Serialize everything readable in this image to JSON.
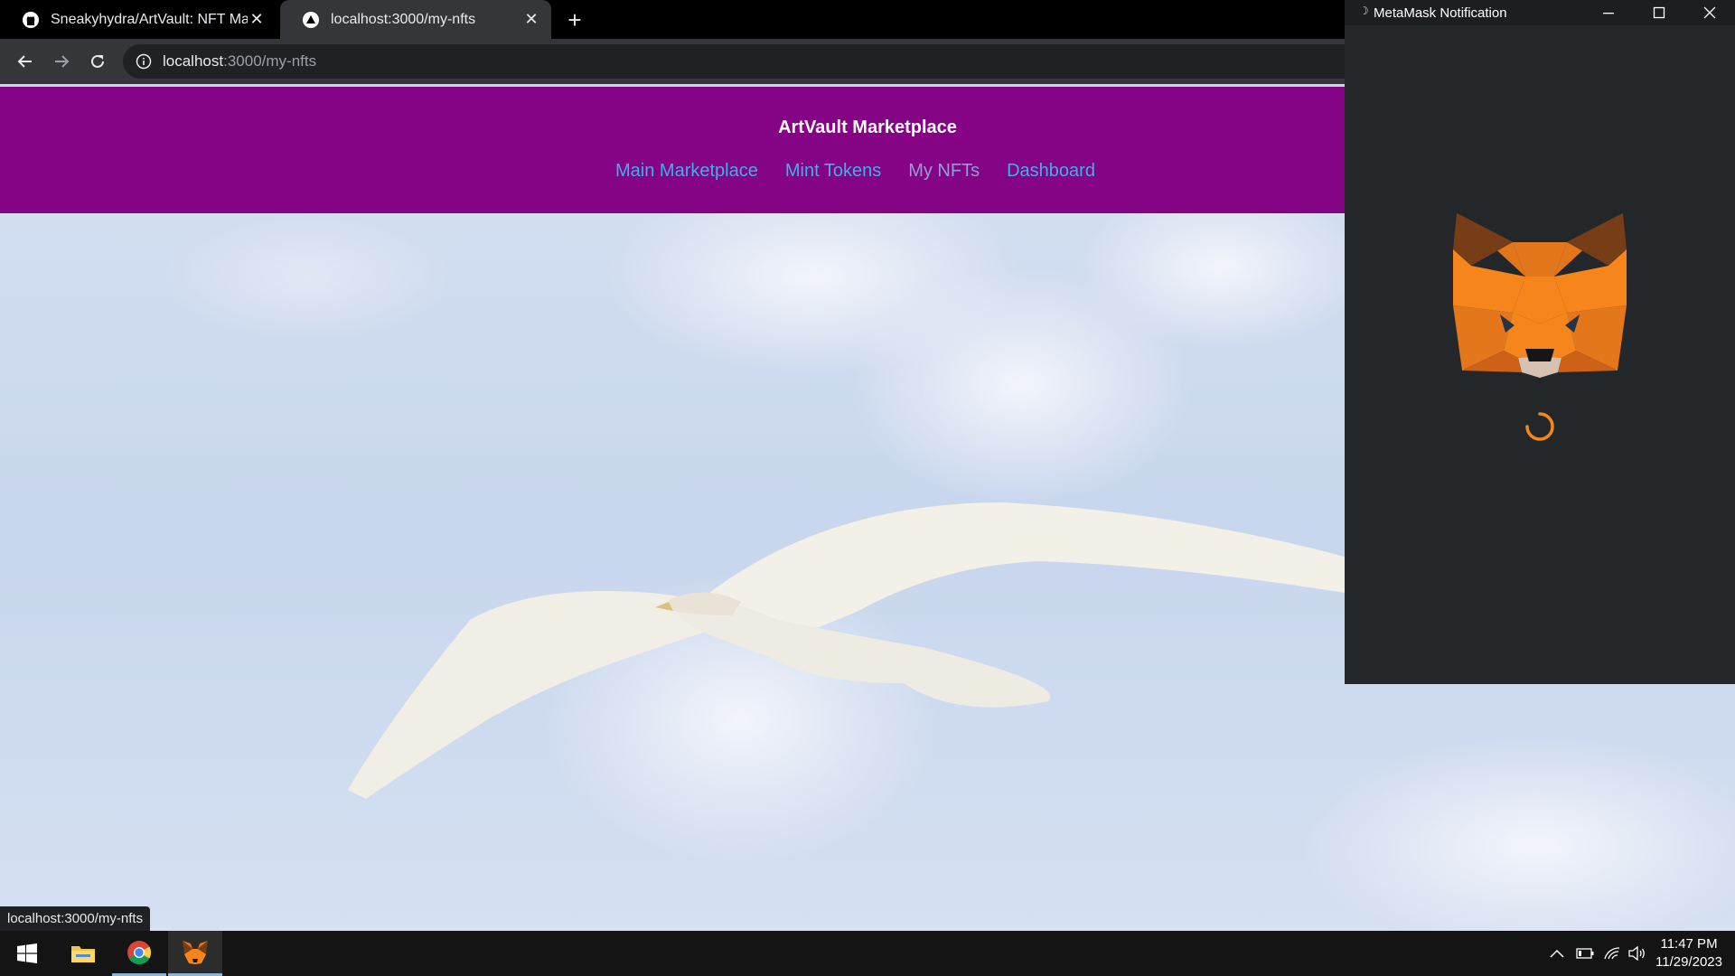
{
  "browser": {
    "tabs": [
      {
        "title": "Sneakyhydra/ArtVault: NFT Mark",
        "icon": "github-icon"
      },
      {
        "title": "localhost:3000/my-nfts",
        "icon": "triangle-icon"
      }
    ],
    "url_host": "localhost",
    "url_path": ":3000/my-nfts",
    "status_url": "localhost:3000/my-nfts"
  },
  "app": {
    "title": "ArtVault Marketplace",
    "nav": [
      "Main Marketplace",
      "Mint Tokens",
      "My NFTs",
      "Dashboard"
    ],
    "current_nav": "My NFTs",
    "colors": {
      "header_bg": "#850385",
      "link": "#3fb0e8",
      "current_link": "#8e9ed6"
    }
  },
  "metamask": {
    "window_title": "MetaMask Notification",
    "colors": {
      "bg": "#24272a",
      "spinner": "#f6851b"
    }
  },
  "taskbar": {
    "apps": [
      "windows-start-icon",
      "file-explorer-icon",
      "chrome-icon",
      "metamask-icon"
    ],
    "time": "11:47 PM",
    "date": "11/29/2023"
  }
}
